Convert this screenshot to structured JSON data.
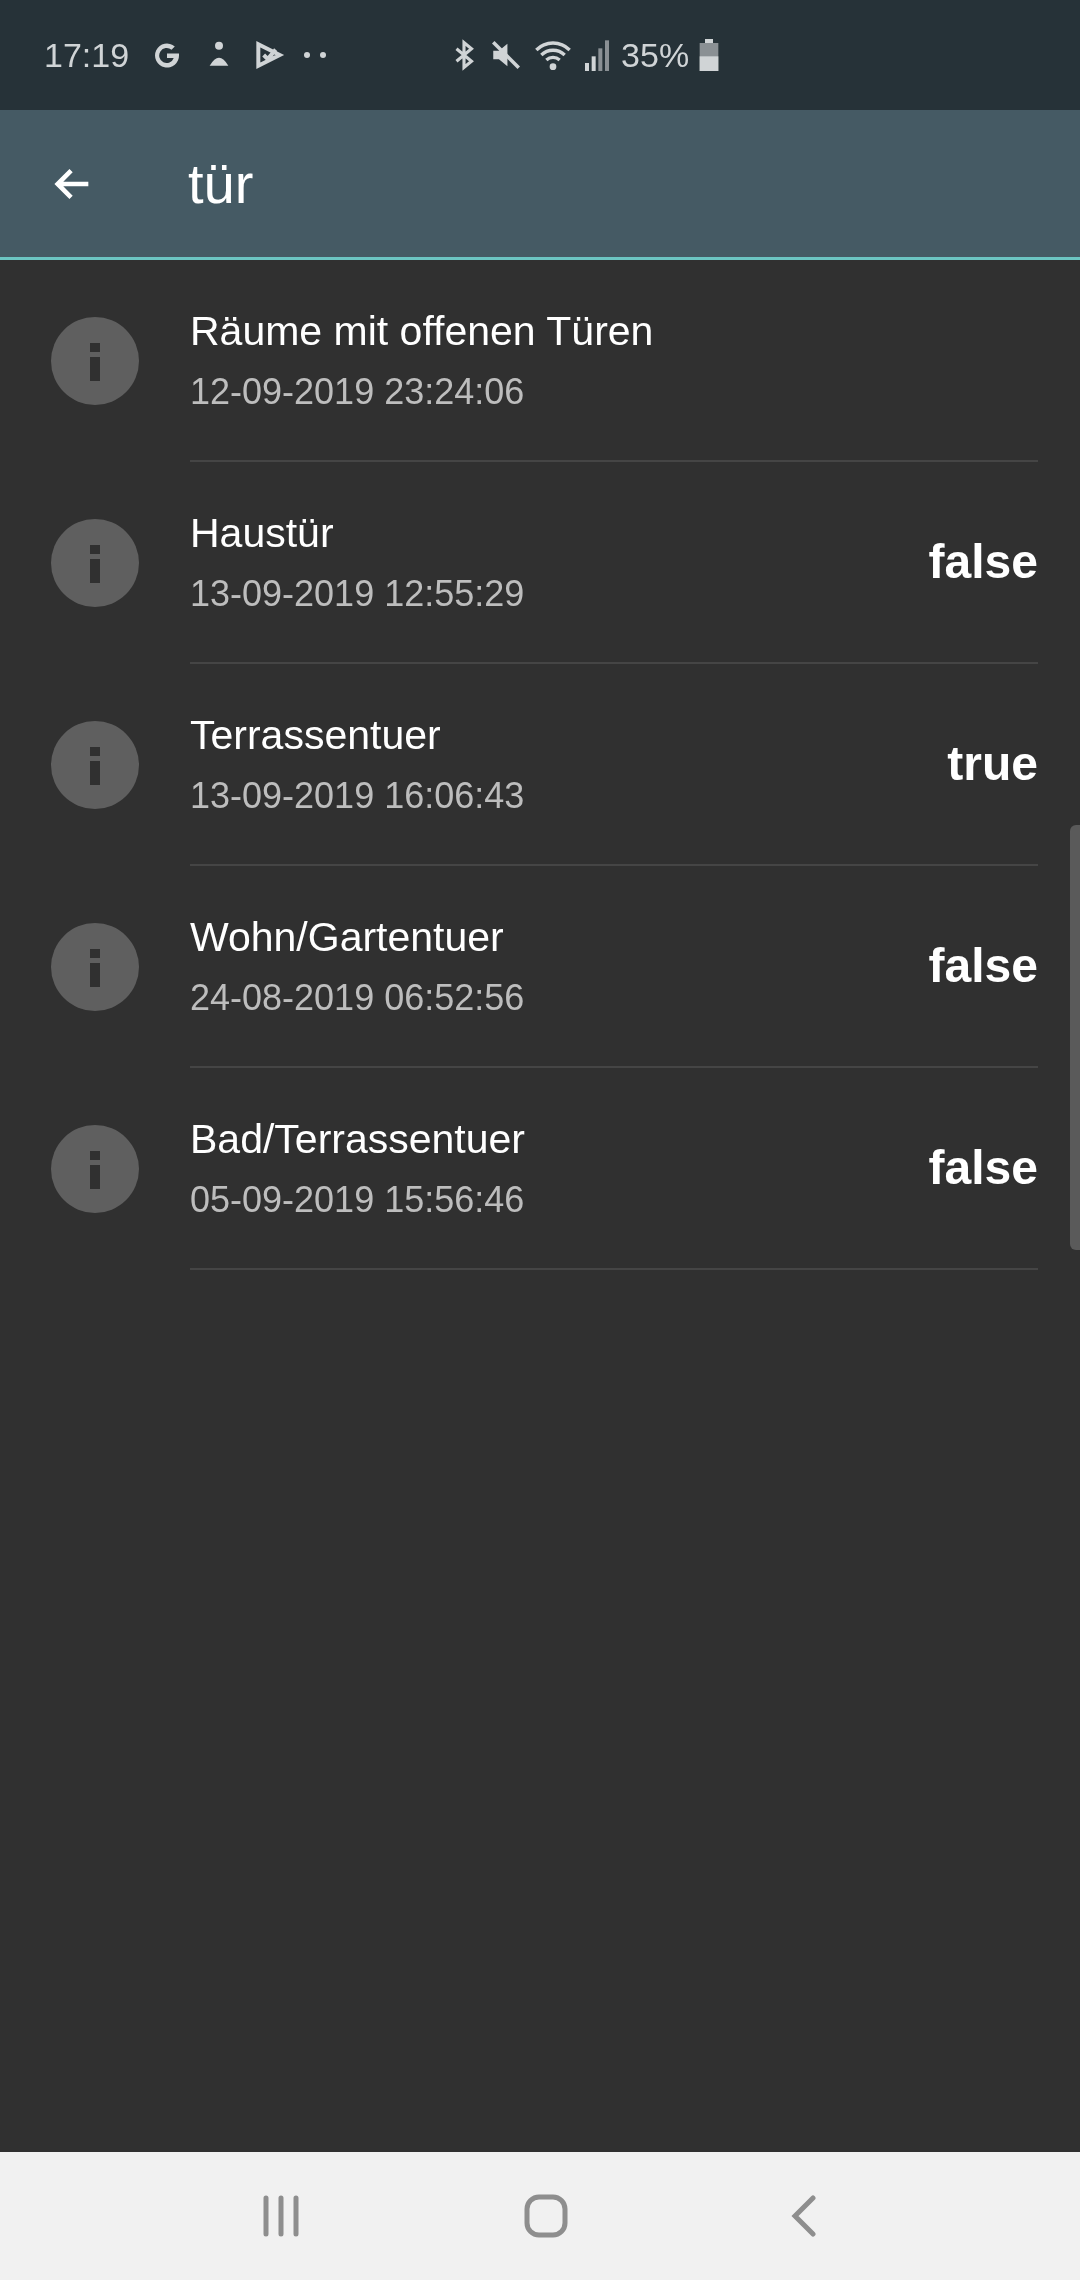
{
  "status_bar": {
    "time": "17:19",
    "battery": "35%"
  },
  "app_bar": {
    "title": "tür"
  },
  "items": [
    {
      "name": "Räume mit offenen Türen",
      "timestamp": "12-09-2019 23:24:06"
    },
    {
      "name": "Haustür",
      "timestamp": "13-09-2019 12:55:29",
      "value": "false"
    },
    {
      "name": "Terrassentuer",
      "timestamp": "13-09-2019 16:06:43",
      "value": "true"
    },
    {
      "name": "Wohn/Gartentuer",
      "timestamp": "24-08-2019 06:52:56",
      "value": "false"
    },
    {
      "name": "Bad/Terrassentuer",
      "timestamp": "05-09-2019 15:56:46",
      "value": "false"
    }
  ]
}
